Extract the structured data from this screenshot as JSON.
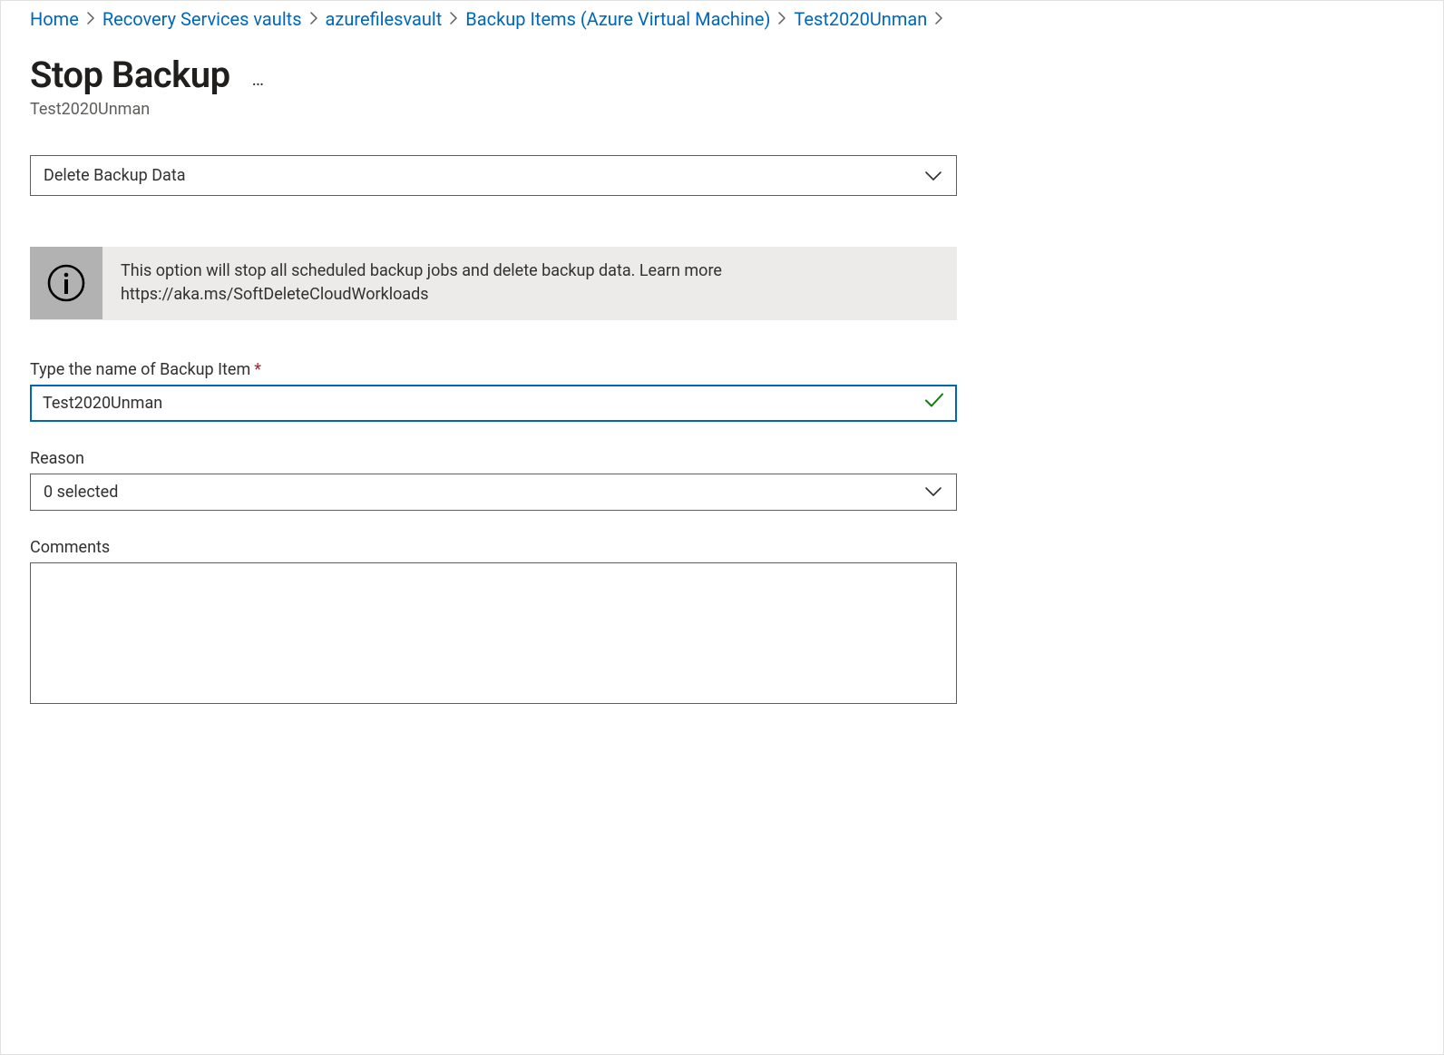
{
  "breadcrumb": {
    "items": [
      {
        "label": "Home"
      },
      {
        "label": "Recovery Services vaults"
      },
      {
        "label": "azurefilesvault"
      },
      {
        "label": "Backup Items (Azure Virtual Machine)"
      },
      {
        "label": "Test2020Unman"
      }
    ]
  },
  "header": {
    "title": "Stop Backup",
    "subtitle": "Test2020Unman"
  },
  "action_select": {
    "value": "Delete Backup Data"
  },
  "info_banner": {
    "line1": "This option will stop all scheduled backup jobs and delete backup data. Learn more",
    "line2": "https://aka.ms/SoftDeleteCloudWorkloads"
  },
  "fields": {
    "name_label": "Type the name of Backup Item",
    "name_value": "Test2020Unman",
    "reason_label": "Reason",
    "reason_value": "0 selected",
    "comments_label": "Comments",
    "comments_value": ""
  }
}
